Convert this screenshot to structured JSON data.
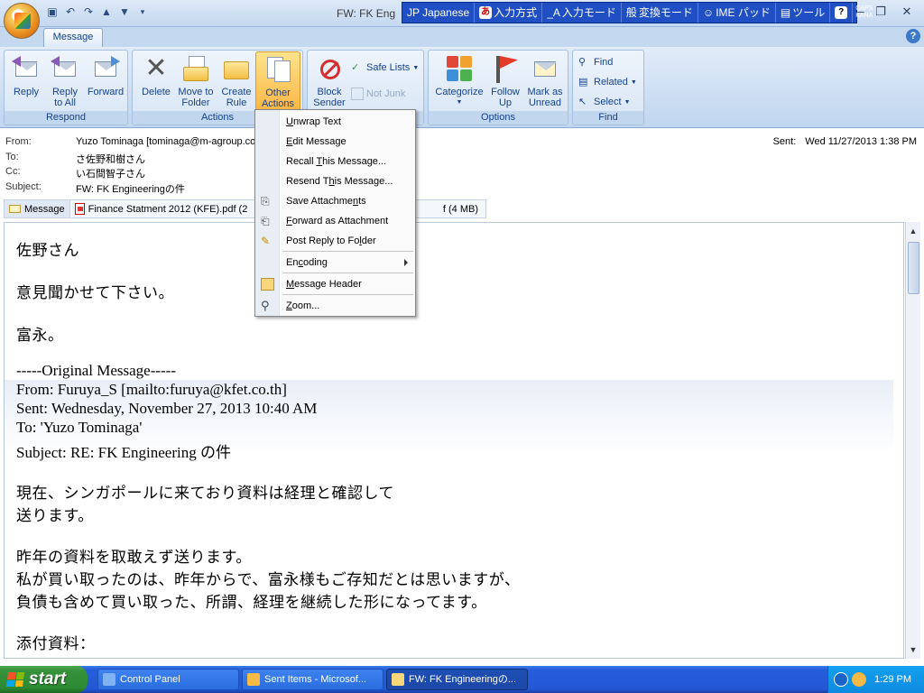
{
  "window": {
    "title": "FW: FK Eng",
    "qat": [
      "save-icon",
      "undo-icon",
      "redo-icon",
      "up-icon",
      "down-icon",
      "customize-icon"
    ]
  },
  "ime": {
    "lang": "JP Japanese",
    "input_method": "入力方式",
    "input_mode": "入力モード",
    "convert_mode": "変換モード",
    "ime_pad": "IME パッド",
    "tools": "ツール",
    "caps": "CAPS",
    "kana": "KANA"
  },
  "ribbon": {
    "tab": "Message",
    "groups": {
      "respond": "Respond",
      "actions": "Actions",
      "options": "Options",
      "find": "Find"
    },
    "buttons": {
      "reply": [
        "Reply",
        ""
      ],
      "reply_all": [
        "Reply",
        "to All"
      ],
      "forward": [
        "Forward",
        ""
      ],
      "delete": [
        "Delete",
        ""
      ],
      "move": [
        "Move to",
        "Folder"
      ],
      "create": [
        "Create",
        "Rule"
      ],
      "other": [
        "Other",
        "Actions"
      ],
      "block": [
        "Block",
        "Sender"
      ],
      "safe_lists": "Safe Lists",
      "not_junk": "Not Junk",
      "categorize": [
        "Categorize",
        ""
      ],
      "follow": [
        "Follow",
        "Up"
      ],
      "mark": [
        "Mark as",
        "Unread"
      ],
      "find": "Find",
      "related": "Related",
      "select": "Select"
    }
  },
  "headers": {
    "from_label": "From:",
    "from_value": "Yuzo Tominaga [tominaga@m-agroup.com]",
    "to_label": "To:",
    "to_value": "さ佐野和樹さん",
    "cc_label": "Cc:",
    "cc_value": "い石間智子さん",
    "subject_label": "Subject:",
    "subject_value": "FW: FK Engineeringの件",
    "sent_label": "Sent:",
    "sent_value": "Wed 11/27/2013 1:38 PM"
  },
  "attachments": {
    "message": "Message",
    "file1": "Finance Statment 2012 (KFE).pdf (2",
    "file2_tail": "f (4 MB)"
  },
  "body": {
    "greeting": "佐野さん",
    "line1": "意見聞かせて下さい。",
    "sign": "富永。",
    "orig_header": "-----Original Message-----",
    "orig_from": "From: Furuya_S [mailto:furuya@kfet.co.th]",
    "orig_sent": "Sent: Wednesday, November 27, 2013 10:40 AM",
    "orig_to": "To: 'Yuzo Tominaga'",
    "orig_subject": "Subject: RE: FK Engineering の件",
    "p1a": "現在、シンガポールに来ており資料は経理と確認して",
    "p1b": "送ります。",
    "p2a": "昨年の資料を取敢えず送ります。",
    "p2b": "私が買い取ったのは、昨年からで、富永様もご存知だとは思いますが、",
    "p2c": "負債も含めて買い取った、所謂、経理を継続した形になってます。",
    "p3": "添付資料："
  },
  "menu": {
    "items": [
      {
        "pre": "",
        "key": "U",
        "post": "nwrap Text",
        "icon": ""
      },
      {
        "pre": "",
        "key": "E",
        "post": "dit Message",
        "icon": ""
      },
      {
        "pre": "Recall ",
        "key": "T",
        "post": "his Message...",
        "icon": ""
      },
      {
        "pre": "Resend T",
        "key": "h",
        "post": "is Message...",
        "icon": ""
      },
      {
        "pre": "Save Attachme",
        "key": "n",
        "post": "ts",
        "icon": "save-attachments-icon"
      },
      {
        "pre": "",
        "key": "F",
        "post": "orward as Attachment",
        "icon": "forward-attachment-icon"
      },
      {
        "pre": "Post Reply to Fo",
        "key": "l",
        "post": "der",
        "icon": "post-reply-icon"
      },
      {
        "pre": "En",
        "key": "c",
        "post": "oding",
        "icon": ""
      },
      {
        "pre": "",
        "key": "M",
        "post": "essage Header",
        "icon": "message-header-icon"
      },
      {
        "pre": "",
        "key": "Z",
        "post": "oom...",
        "icon": "zoom-icon"
      }
    ]
  },
  "taskbar": {
    "start": "start",
    "task1": "Control Panel",
    "task2": "Sent Items - Microsof...",
    "task3": "FW: FK Engineeringの...",
    "clock": "1:29 PM"
  }
}
